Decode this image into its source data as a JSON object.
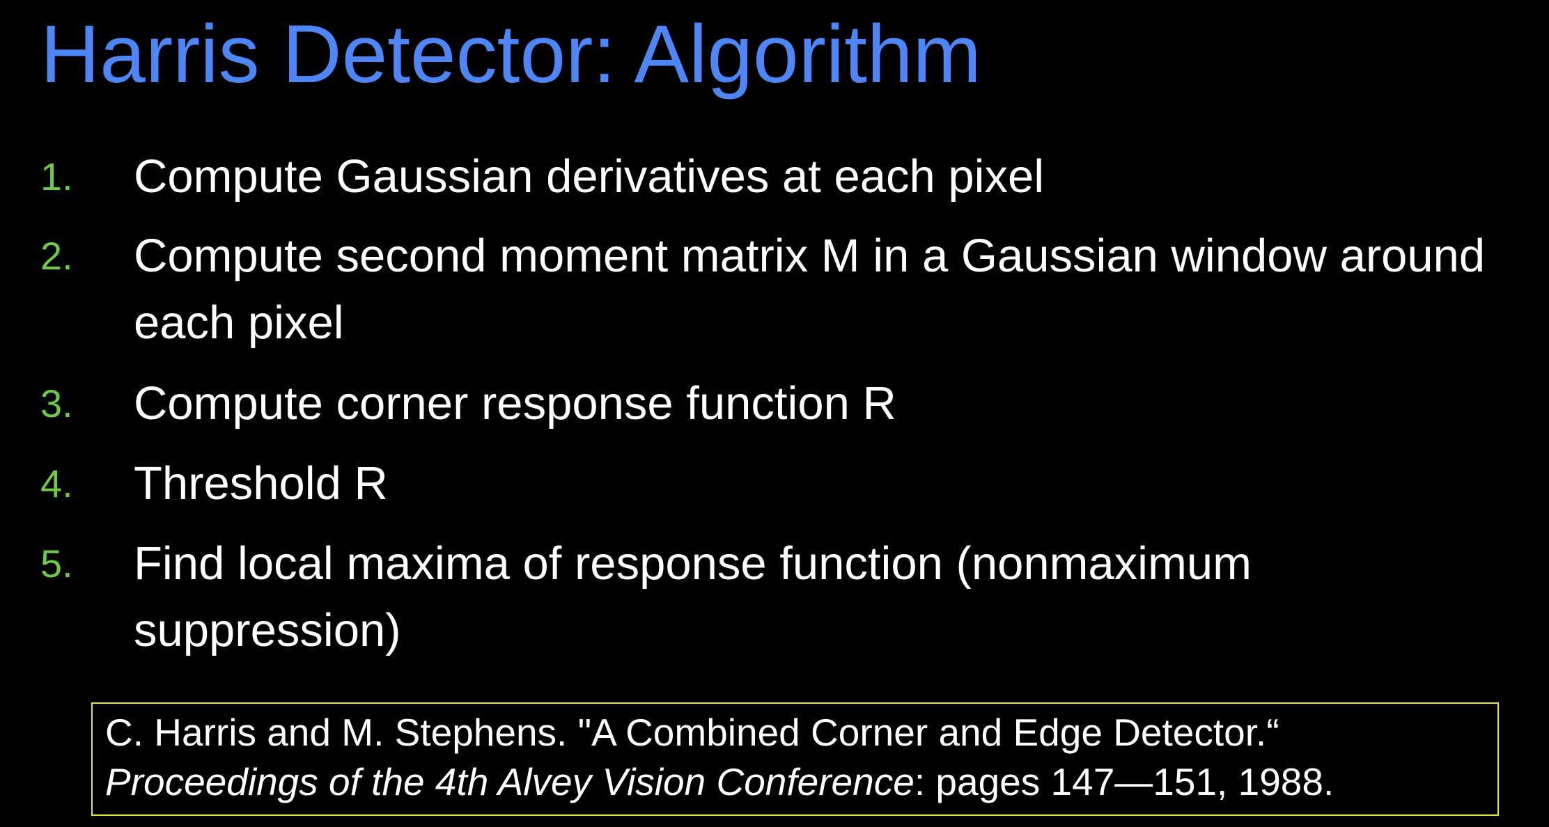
{
  "slide": {
    "title": "Harris Detector: Algorithm",
    "steps": [
      {
        "number": "1.",
        "text": "Compute Gaussian derivatives at each pixel"
      },
      {
        "number": "2.",
        "text": "Compute second moment matrix M in a Gaussian window around each pixel"
      },
      {
        "number": "3.",
        "text": "Compute corner response function R"
      },
      {
        "number": "4.",
        "text": "Threshold R"
      },
      {
        "number": "5.",
        "text": "Find local maxima of response function (nonmaximum suppression)"
      }
    ],
    "citation": {
      "line1": "C. Harris and M. Stephens. \"A Combined Corner and Edge Detector.“",
      "venue": "Proceedings of the 4th Alvey Vision Conference",
      "details": ": pages 147—151, 1988."
    }
  },
  "colors": {
    "background": "#000000",
    "title": "#4f86f7",
    "step_number": "#70c84a",
    "text": "#ffffff",
    "citation_border": "#e6e63a"
  }
}
